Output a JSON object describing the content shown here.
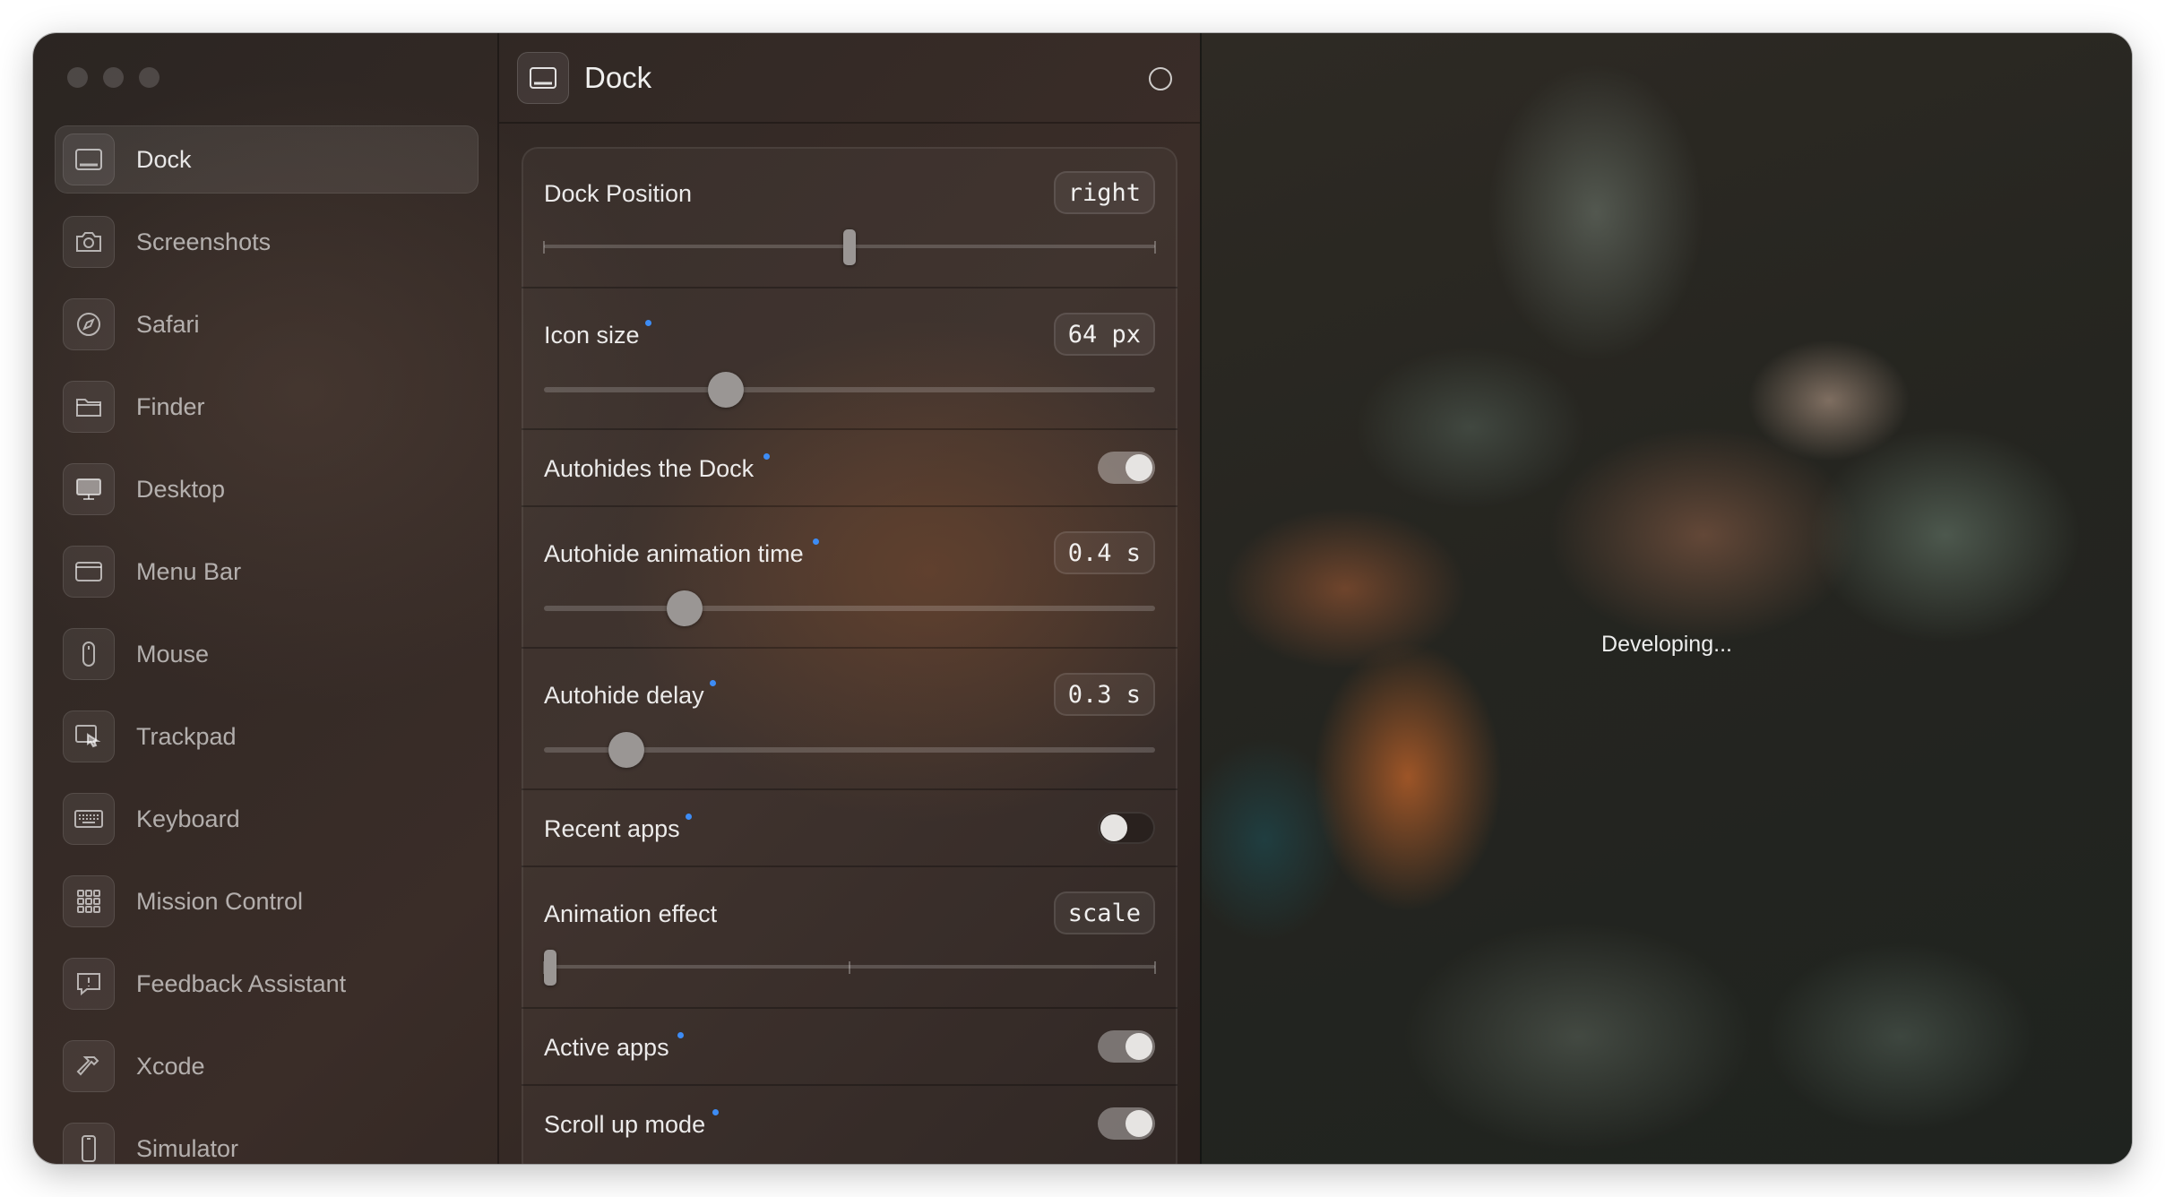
{
  "window": {
    "traffic_lights": [
      "close-button",
      "minimize-button",
      "zoom-button"
    ]
  },
  "sidebar": {
    "items": [
      {
        "label": "Dock",
        "icon": "dock-icon",
        "active": true
      },
      {
        "label": "Screenshots",
        "icon": "camera-icon",
        "active": false
      },
      {
        "label": "Safari",
        "icon": "compass-icon",
        "active": false
      },
      {
        "label": "Finder",
        "icon": "folder-icon",
        "active": false
      },
      {
        "label": "Desktop",
        "icon": "monitor-icon",
        "active": false
      },
      {
        "label": "Menu Bar",
        "icon": "menubar-icon",
        "active": false
      },
      {
        "label": "Mouse",
        "icon": "mouse-icon",
        "active": false
      },
      {
        "label": "Trackpad",
        "icon": "trackpad-icon",
        "active": false
      },
      {
        "label": "Keyboard",
        "icon": "keyboard-icon",
        "active": false
      },
      {
        "label": "Mission Control",
        "icon": "grid-icon",
        "active": false
      },
      {
        "label": "Feedback Assistant",
        "icon": "feedback-icon",
        "active": false
      },
      {
        "label": "Xcode",
        "icon": "hammer-icon",
        "active": false
      },
      {
        "label": "Simulator",
        "icon": "phone-icon",
        "active": false
      }
    ]
  },
  "pane": {
    "title": "Dock",
    "header_icon": "dock-icon",
    "settings": {
      "dock_position": {
        "label": "Dock Position",
        "value": "right",
        "slider_fraction": 0.5,
        "options_count": 3
      },
      "icon_size": {
        "label": "Icon size",
        "value": "64 px",
        "slider_fraction": 0.297,
        "modified": true
      },
      "autohide": {
        "label": "Autohides the Dock",
        "on": true,
        "modified": true
      },
      "autohide_time": {
        "label": "Autohide animation time",
        "value": "0.4 s",
        "slider_fraction": 0.23,
        "modified": true
      },
      "autohide_delay": {
        "label": "Autohide delay",
        "value": "0.3 s",
        "slider_fraction": 0.135,
        "modified": true
      },
      "recent_apps": {
        "label": "Recent apps",
        "on": false,
        "modified": true
      },
      "animation_effect": {
        "label": "Animation effect",
        "value": "scale",
        "slider_fraction": 0.0,
        "options_count": 3
      },
      "active_apps": {
        "label": "Active apps",
        "on": true,
        "modified": true
      },
      "scroll_up": {
        "label": "Scroll up mode",
        "on": true,
        "modified": true
      }
    }
  },
  "preview": {
    "status": "Developing..."
  },
  "colors": {
    "accent_dot": "#3d8cf5"
  }
}
